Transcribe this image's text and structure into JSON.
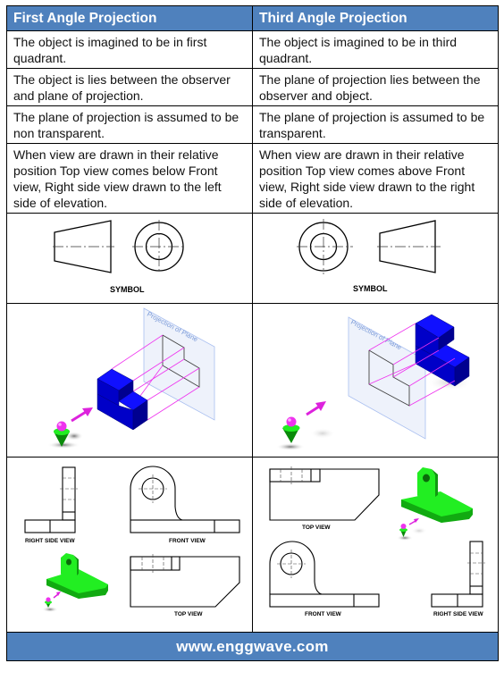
{
  "table": {
    "headers": [
      "First Angle Projection",
      "Third Angle Projection"
    ],
    "rows": [
      [
        "The object is imagined to be in first quadrant.",
        "The object is imagined to be in third quadrant."
      ],
      [
        "The object is lies between the observer and plane of projection.",
        "The plane of projection lies between the observer and object."
      ],
      [
        "The plane of projection is assumed to be non transparent.",
        "The plane of projection is assumed to be transparent."
      ],
      [
        "When view are drawn in their relative position Top view comes below Front view, Right side view drawn to the left side of elevation.",
        "When view are drawn in their relative position Top view comes above Front view, Right side view drawn to the right side of elevation."
      ]
    ],
    "symbol_label": "SYMBOL",
    "plane_label": "Projection of Plane",
    "views": {
      "first": {
        "right_side": "RIGHT SIDE VIEW",
        "front": "FRONT VIEW",
        "top": "TOP VIEW"
      },
      "third": {
        "top": "TOP VIEW",
        "front": "FRONT VIEW",
        "right_side": "RIGHT  SIDE VIEW"
      }
    }
  },
  "footer": {
    "website": "www.enggwave.com"
  },
  "colors": {
    "header_bg": "#4f81bd",
    "block_blue": "#0000cc",
    "part_green": "#22ee22",
    "projector_magenta": "#ee22ee"
  }
}
